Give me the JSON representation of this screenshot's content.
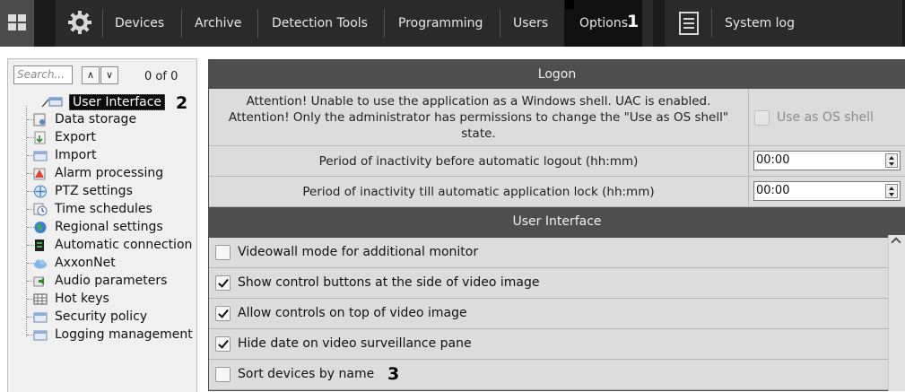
{
  "topbar": {
    "menu": [
      "Devices",
      "Archive",
      "Detection Tools",
      "Programming",
      "Users",
      "Options"
    ],
    "system_log": "System log",
    "callout_options": "1"
  },
  "left": {
    "search_placeholder": "Search...",
    "up": "∧",
    "down": "∨",
    "count": "0 of 0",
    "callout_selected": "2",
    "items": [
      "User Interface",
      "Data storage",
      "Export",
      "Import",
      "Alarm processing",
      "PTZ settings",
      "Time schedules",
      "Regional settings",
      "Automatic connection",
      "AxxonNet",
      "Audio parameters",
      "Hot keys",
      "Security policy",
      "Logging management"
    ]
  },
  "logon": {
    "title": "Logon",
    "shell_warning_line1": "Attention! Unable to use the application as a Windows shell. UAC is enabled.",
    "shell_warning_line2": "Attention! Only the administrator has permissions to change the \"Use as OS shell\"",
    "shell_warning_line3": "state.",
    "use_as_shell_label": "Use as OS shell",
    "logout_label": "Period of inactivity before automatic logout (hh:mm)",
    "logout_value": "00:00",
    "lock_label": "Period of inactivity till automatic application lock (hh:mm)",
    "lock_value": "00:00"
  },
  "ui": {
    "title": "User Interface",
    "options": [
      {
        "label": "Videowall mode for additional monitor",
        "checked": false
      },
      {
        "label": "Show control buttons at the side of video image",
        "checked": true
      },
      {
        "label": "Allow controls on top of video image",
        "checked": true
      },
      {
        "label": "Hide date on video surveillance pane",
        "checked": true
      },
      {
        "label": "Sort devices by name",
        "checked": false
      }
    ],
    "callout_sort": "3"
  }
}
